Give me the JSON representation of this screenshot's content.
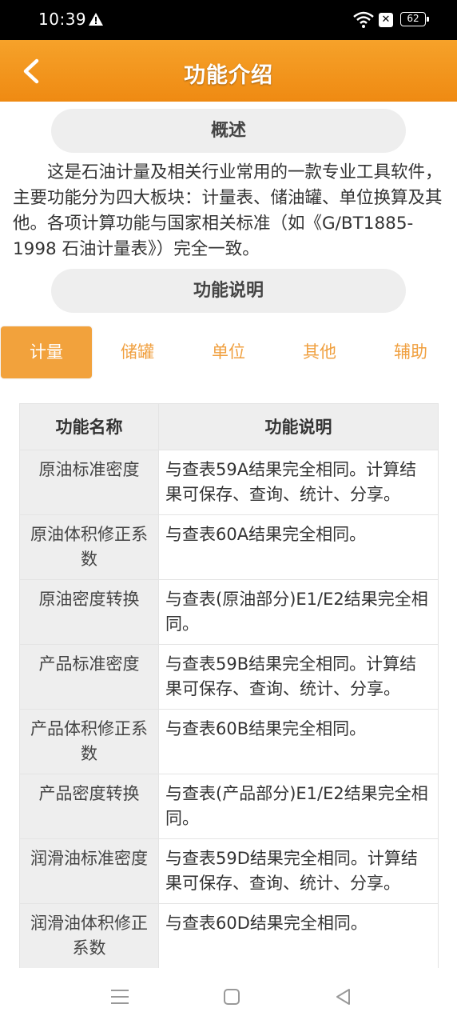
{
  "status_bar": {
    "time": "10:39",
    "battery": "62"
  },
  "app_bar": {
    "title": "功能介绍"
  },
  "overview": {
    "heading": "概述",
    "text": "这是石油计量及相关行业常用的一款专业工具软件，主要功能分为四大板块：计量表、储油罐、单位换算及其他。各项计算功能与国家相关标准（如《G/BT1885-1998 石油计量表》）完全一致。"
  },
  "function_section": {
    "heading": "功能说明"
  },
  "tabs": [
    {
      "label": "计量",
      "active": true
    },
    {
      "label": "储罐",
      "active": false
    },
    {
      "label": "单位",
      "active": false
    },
    {
      "label": "其他",
      "active": false
    },
    {
      "label": "辅助",
      "active": false
    }
  ],
  "table": {
    "headers": [
      "功能名称",
      "功能说明"
    ],
    "rows": [
      {
        "name": "原油标准密度",
        "desc": "与查表59A结果完全相同。计算结果可保存、查询、统计、分享。"
      },
      {
        "name": "原油体积修正系数",
        "desc": "与查表60A结果完全相同。"
      },
      {
        "name": "原油密度转换",
        "desc": "与查表(原油部分)E1/E2结果完全相同。"
      },
      {
        "name": "产品标准密度",
        "desc": "与查表59B结果完全相同。计算结果可保存、查询、统计、分享。"
      },
      {
        "name": "产品体积修正系数",
        "desc": "与查表60B结果完全相同。"
      },
      {
        "name": "产品密度转换",
        "desc": "与查表(产品部分)E1/E2结果完全相同。"
      },
      {
        "name": "润滑油标准密度",
        "desc": "与查表59D结果完全相同。计算结果可保存、查询、统计、分享。"
      },
      {
        "name": "润滑油体积修正系数",
        "desc": "与查表60D结果完全相同。"
      }
    ]
  },
  "colors": {
    "accent": "#f2a23c",
    "tab_text": "#f0a040",
    "header_bg": "#eeeeee"
  },
  "icons": [
    "back-arrow-icon",
    "warning-icon",
    "wifi-icon",
    "sim-off-icon",
    "battery-icon",
    "menu-icon",
    "home-icon",
    "back-triangle-icon"
  ]
}
